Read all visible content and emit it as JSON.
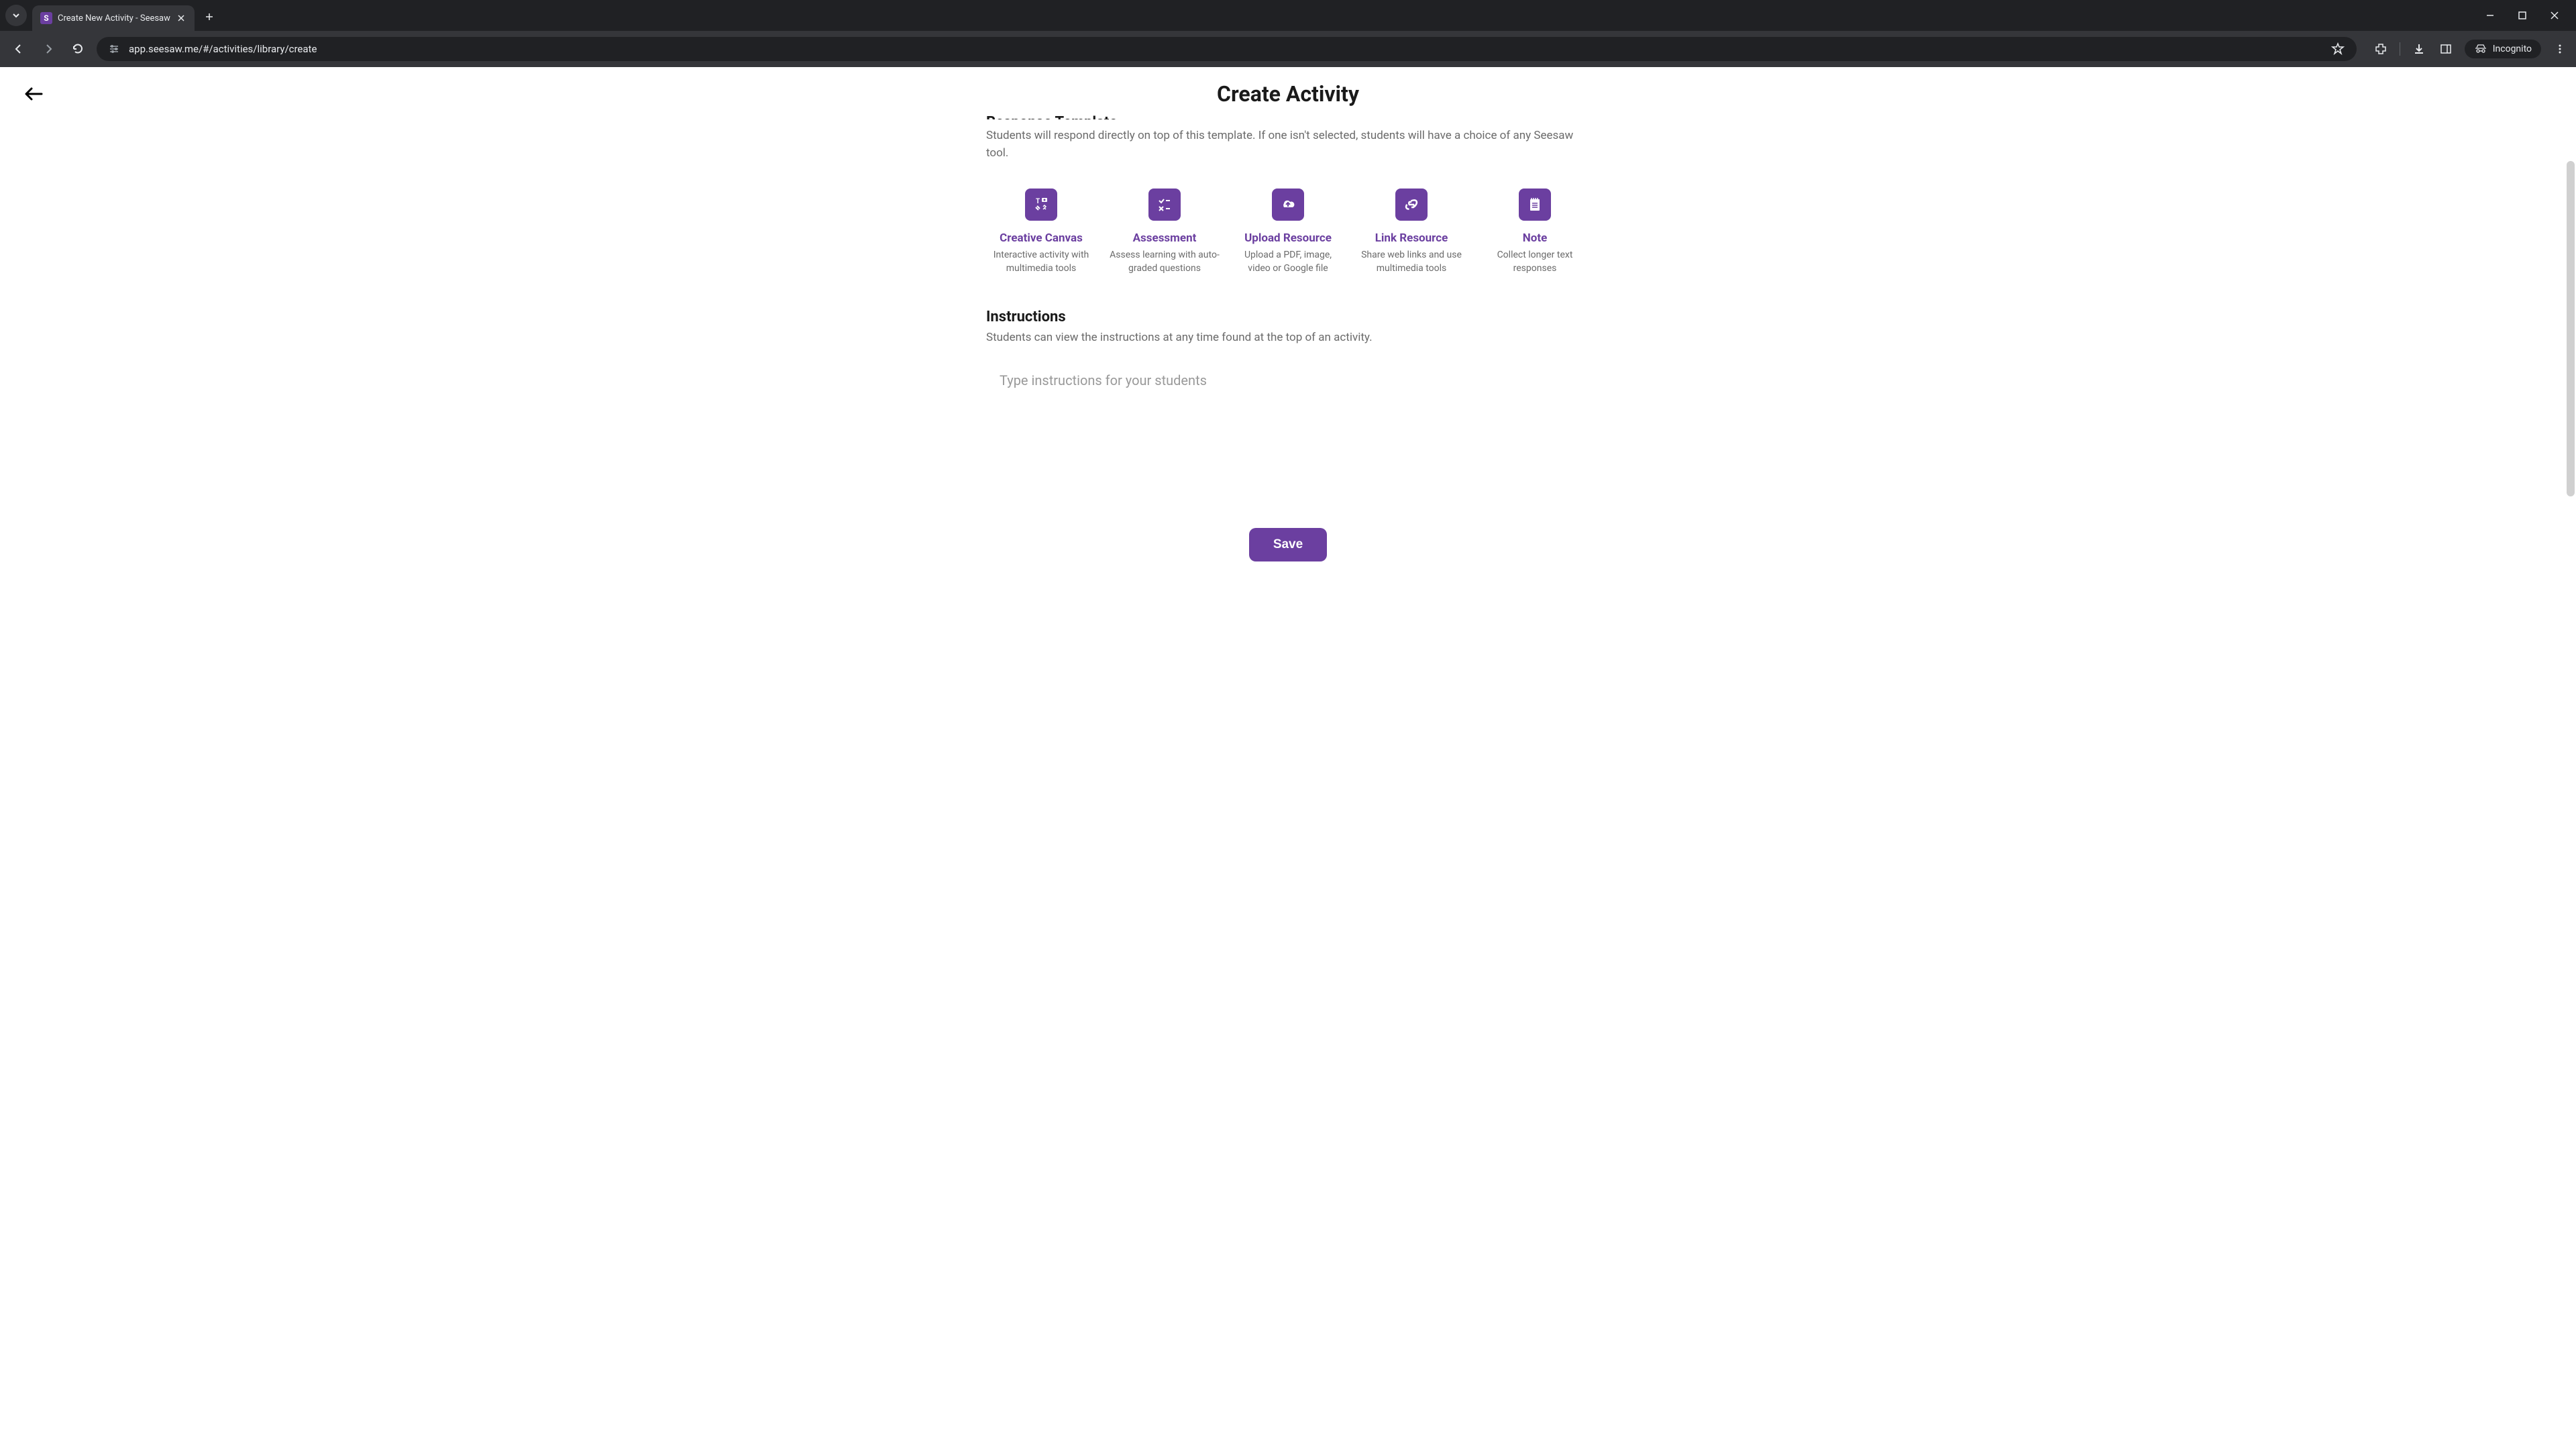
{
  "browser": {
    "tab_title": "Create New Activity - Seesaw",
    "url": "app.seesaw.me/#/activities/library/create",
    "incognito_label": "Incognito"
  },
  "header": {
    "page_title": "Create Activity"
  },
  "response_template": {
    "heading": "Response Template",
    "description": "Students will respond directly on top of this template. If one isn't selected, students will have a choice of any Seesaw tool."
  },
  "templates": [
    {
      "title": "Creative Canvas",
      "description": "Interactive activity with multimedia tools"
    },
    {
      "title": "Assessment",
      "description": "Assess learning with auto-graded questions"
    },
    {
      "title": "Upload Resource",
      "description": "Upload a PDF, image, video or Google file"
    },
    {
      "title": "Link Resource",
      "description": "Share web links and use multimedia tools"
    },
    {
      "title": "Note",
      "description": "Collect longer text responses"
    }
  ],
  "instructions": {
    "heading": "Instructions",
    "description": "Students can view the instructions at any time found at the top of an activity.",
    "placeholder": "Type instructions for your students"
  },
  "save_label": "Save"
}
